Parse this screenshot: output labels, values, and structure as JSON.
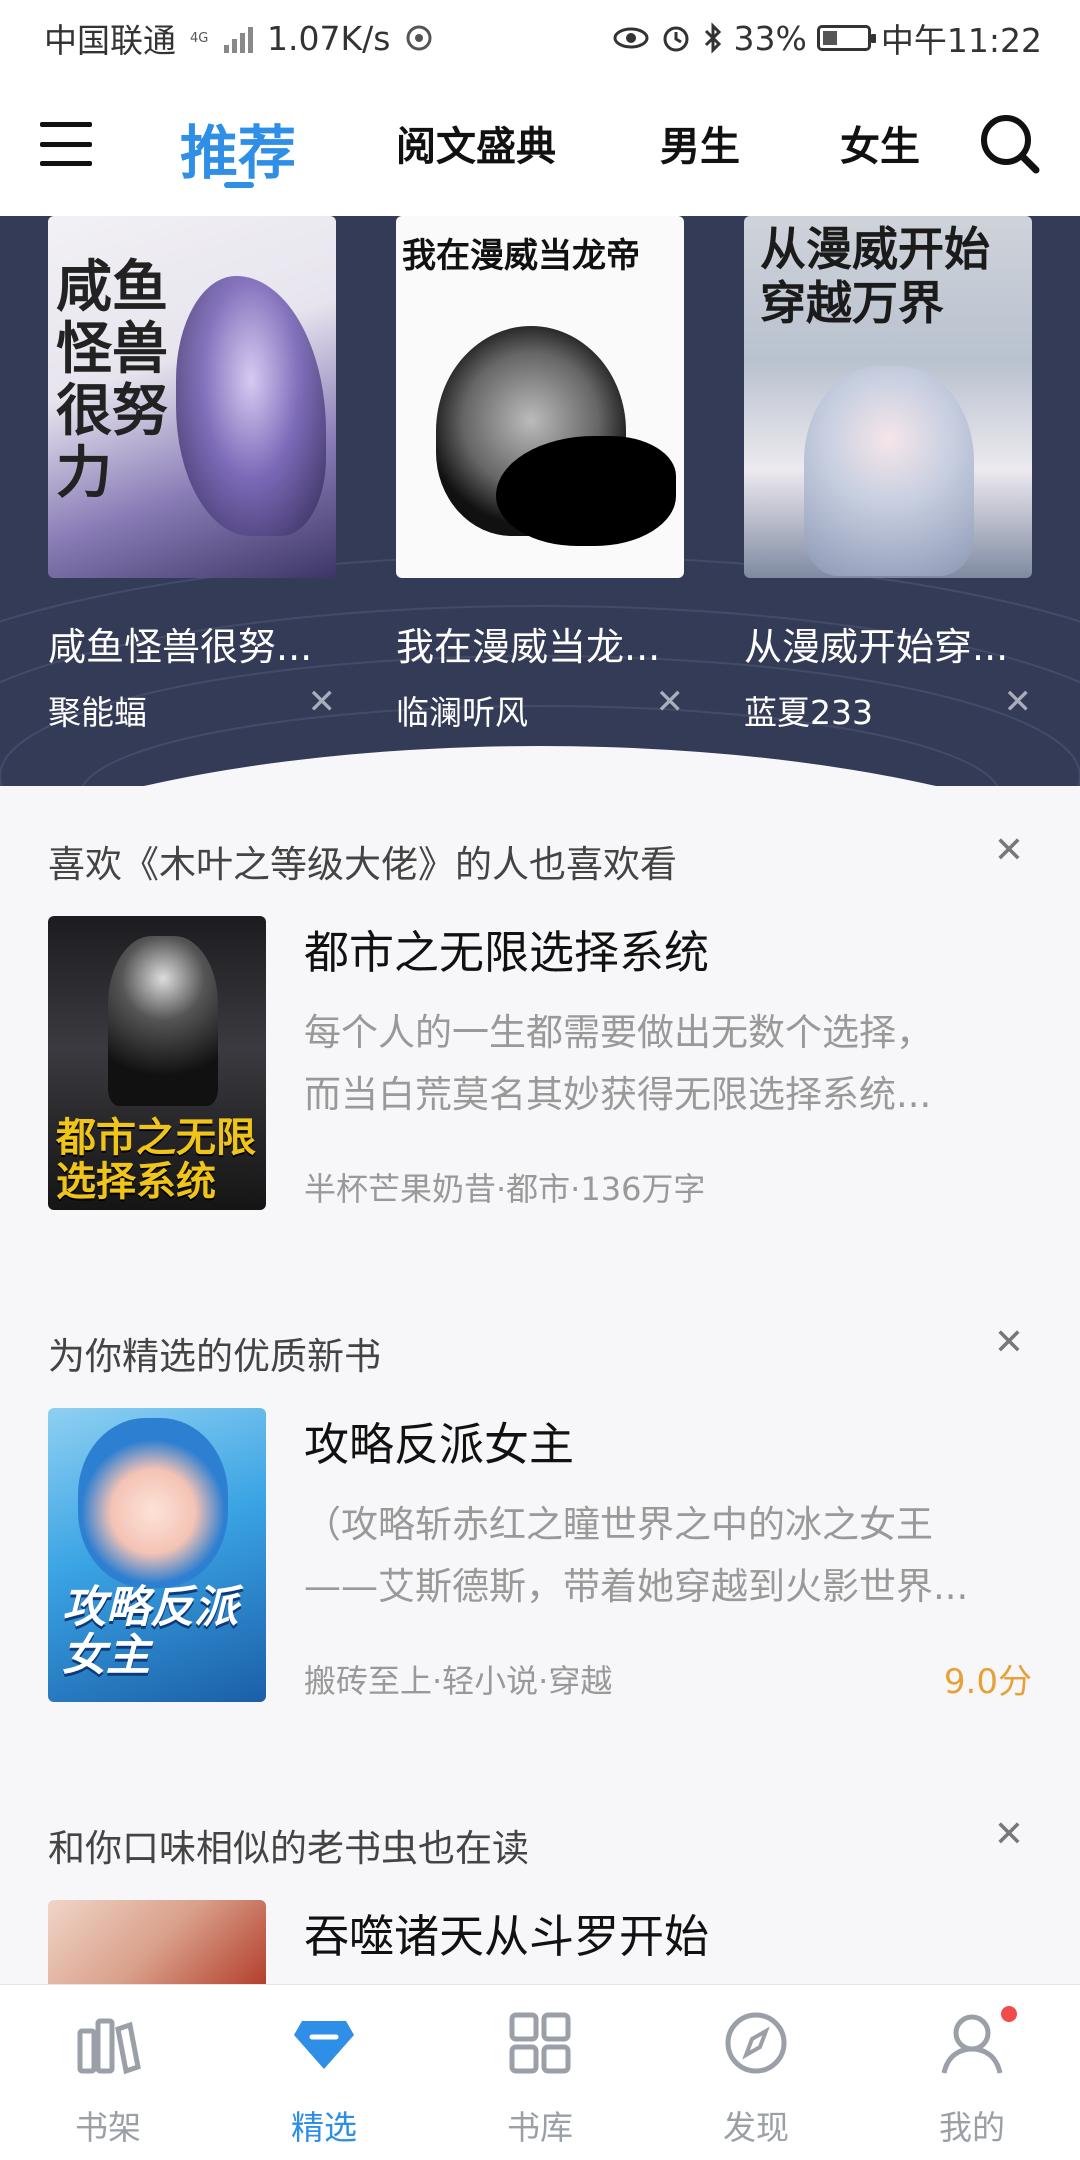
{
  "status_bar": {
    "carrier": "中国联通",
    "network": "4G",
    "speed": "1.07K/s",
    "battery": "33%",
    "time": "中午11:22",
    "icons": [
      "signal-icon",
      "hotspot-icon",
      "eye-icon",
      "alarm-icon",
      "bluetooth-icon",
      "battery-icon"
    ]
  },
  "top_nav": {
    "tabs": [
      {
        "label": "推荐",
        "active": true
      },
      {
        "label": "阅文盛典",
        "active": false
      },
      {
        "label": "男生",
        "active": false
      },
      {
        "label": "女生",
        "active": false
      }
    ],
    "icons": [
      "menu-icon",
      "search-icon"
    ]
  },
  "banner": {
    "books": [
      {
        "title": "咸鱼怪兽很努...",
        "author": "聚能蝠",
        "cover_text": "咸鱼怪兽很努力"
      },
      {
        "title": "我在漫威当龙...",
        "author": "临澜听风",
        "cover_text": "我在漫威当龙帝"
      },
      {
        "title": "从漫威开始穿...",
        "author": "蓝夏233",
        "cover_text": "从漫威开始穿越万界"
      }
    ],
    "close_icon": "close-icon"
  },
  "sections": [
    {
      "title": "喜欢《木叶之等级大佬》的人也喜欢看",
      "book": {
        "title": "都市之无限选择系统",
        "desc_lines": [
          "每个人的一生都需要做出无数个选择，",
          "而当白荒莫名其妙获得无限选择系统..."
        ],
        "meta": "半杯芒果奶昔·都市·136万字",
        "score": "",
        "cover_text": "都市之无限选择系统"
      }
    },
    {
      "title": "为你精选的优质新书",
      "book": {
        "title": "攻略反派女主",
        "desc_lines": [
          "（攻略斩赤红之瞳世界之中的冰之女王",
          "——艾斯德斯，带着她穿越到火影世界..."
        ],
        "meta": "搬砖至上·轻小说·穿越",
        "score": "9.0分",
        "cover_text": "攻略反派女主"
      }
    },
    {
      "title": "和你口味相似的老书虫也在读",
      "book": {
        "title": "吞噬诸天从斗罗开始",
        "desc_lines": [],
        "meta": "",
        "score": ""
      }
    }
  ],
  "bottom_bar": {
    "tabs": [
      {
        "label": "书架",
        "icon": "bookshelf-icon",
        "active": false
      },
      {
        "label": "精选",
        "icon": "diamond-icon",
        "active": true
      },
      {
        "label": "书库",
        "icon": "grid-icon",
        "active": false
      },
      {
        "label": "发现",
        "icon": "compass-icon",
        "active": false
      },
      {
        "label": "我的",
        "icon": "profile-icon",
        "active": false,
        "badge": true
      }
    ]
  },
  "colors": {
    "accent": "#2f8ee6",
    "banner_bg": "#343b57",
    "score": "#e8a13a",
    "badge": "#f24b4b"
  }
}
